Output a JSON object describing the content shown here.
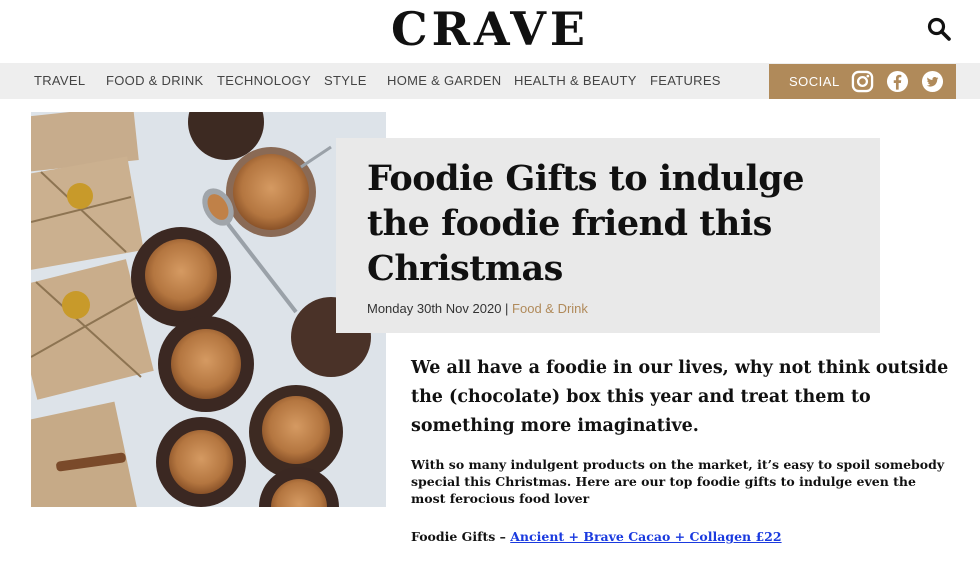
{
  "header": {
    "logo": "CRAVE"
  },
  "nav": {
    "items": [
      "TRAVEL",
      "FOOD & DRINK",
      "TECHNOLOGY",
      "STYLE",
      "HOME & GARDEN",
      "HEALTH & BEAUTY",
      "FEATURES"
    ],
    "social_label": "SOCIAL",
    "social_icons": [
      "instagram-icon",
      "facebook-icon",
      "twitter-icon"
    ]
  },
  "article": {
    "title": "Foodie Gifts to indulge the foodie friend this Christmas",
    "date": "Monday 30th Nov 2020",
    "separator": " | ",
    "category": "Food & Drink",
    "intro": "We all have a foodie in our lives, why not think outside the (chocolate) box this year and treat them to something more imaginative.",
    "paragraph": "With so many indulgent products on the market, it’s easy to spoil somebody special this Christmas. Here are our top foodie gifts to indulge even the most ferocious food lover",
    "gifts_prefix": "Foodie Gifts – ",
    "gifts_link": "Ancient + Brave Cacao + Collagen £22"
  },
  "colors": {
    "accent": "#b08a5a",
    "nav_bg": "#eeeeee",
    "title_box_bg": "#e9e9e9",
    "link": "#1a3adf"
  }
}
